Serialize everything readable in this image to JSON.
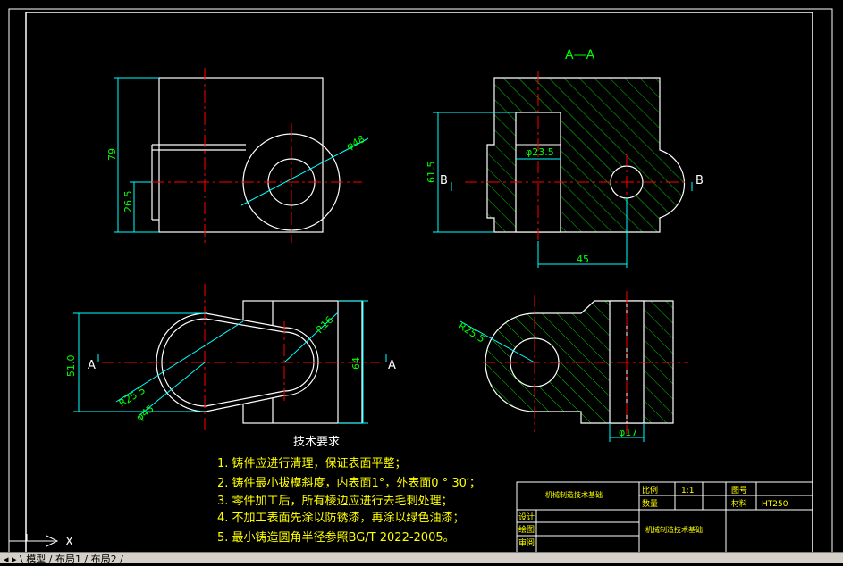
{
  "section_title": "A—A",
  "section_marks": {
    "a_left": "A",
    "a_right": "A",
    "b_left": "B",
    "b_right": "B"
  },
  "dimensions": {
    "front_height": "79",
    "front_lower": "26.5",
    "front_dia": "φ48",
    "sect_height": "61.5",
    "sect_bore": "φ23.5",
    "sect_span": "45",
    "top_width": "51.0",
    "top_height": "64",
    "top_r_large": "R25.5",
    "top_dia": "φ45",
    "top_r_small": "R16",
    "side_radius": "R25.5",
    "side_bore": "φ17"
  },
  "tech_requirements": {
    "heading": "技术要求",
    "items": [
      "1. 铸件应进行清理，保证表面平整；",
      "2. 铸件最小拔模斜度，内表面1°，外表面0 ° 30′；",
      "3. 零件加工后，所有棱边应进行去毛刺处理；",
      "4. 不加工表面先涂以防锈漆，再涂以绿色油漆；",
      "5. 最小铸造圆角半径参照BG/T 2022-2005。"
    ]
  },
  "title_block": {
    "drawing_name": "机械制造技术基础",
    "part_name": "机械制造技术基础",
    "scale_label": "比例",
    "scale_value": "1:1",
    "quantity_label": "数量",
    "drawing_no_label": "图号",
    "material_label": "材料",
    "material_value": "HT250",
    "design_label": "设计",
    "draft_label": "绘图",
    "review_label": "审阅"
  },
  "status_tabs": "◂ ▸ \\ 模型 / 布局1 / 布局2 /",
  "ucs_label": "X",
  "colors": {
    "background": "#000000",
    "outline": "#ffffff",
    "centerline": "#ff0000",
    "dimension": "#00ffff",
    "dim_text": "#00ff00",
    "hatch": "#00cc00",
    "title_text": "#ffff00"
  }
}
